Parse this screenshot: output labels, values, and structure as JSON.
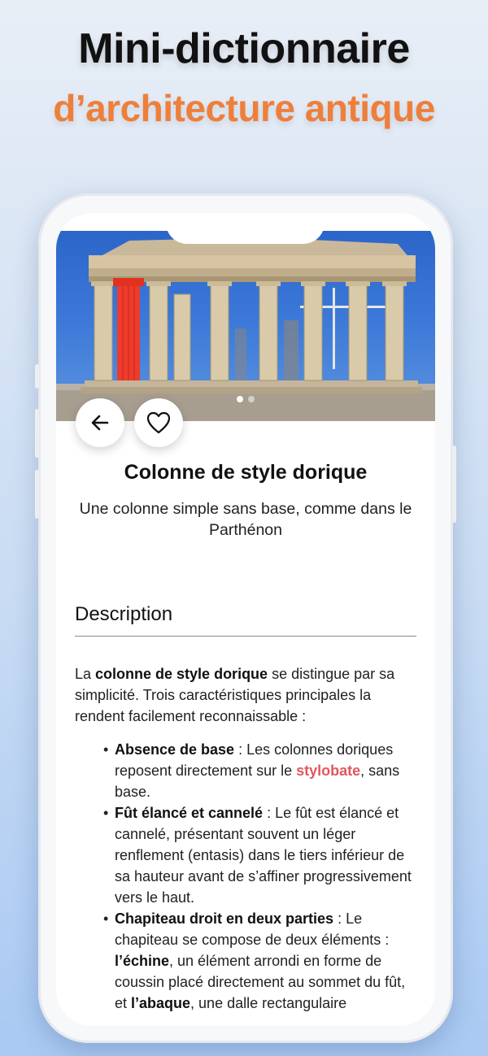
{
  "promo": {
    "title": "Mini-dictionnaire",
    "subtitle": "d’architecture antique"
  },
  "hero": {
    "image_alt": "Parthénon avec une colonne dorique en rouge",
    "highlight_color": "#ee3b2b",
    "page_count": 2,
    "active_page": 1
  },
  "actions": {
    "back_icon": "arrow-left-icon",
    "favorite_icon": "heart-outline-icon"
  },
  "entry": {
    "title": "Colonne de style dorique",
    "subtitle": "Une colonne simple sans base, comme dans le Parthénon"
  },
  "description": {
    "heading": "Description",
    "intro_before": "La ",
    "intro_term": "colonne de style dorique",
    "intro_after": " se distingue par sa simplicité. Trois caractéristiques principales la rendent facilement reconnaissable :",
    "items": [
      {
        "term": "Absence de base",
        "text_before": " : Les colonnes doriques reposent directement sur le ",
        "link": "stylobate",
        "text_after": ", sans base."
      },
      {
        "term": "Fût élancé et cannelé",
        "text": " : Le fût est élancé et cannelé, présentant souvent un léger renflement (entasis) dans le tiers inférieur de sa hauteur avant de s’affiner progressivement vers le haut."
      },
      {
        "term": "Chapiteau droit en deux parties",
        "text_before": " : Le chapiteau se compose de deux éléments : ",
        "term2": "l’échine",
        "text_middle": ", un élément arrondi en forme de coussin placé directement au sommet du fût, et ",
        "term3": "l’abaque",
        "text_after": ", une dalle rectangulaire"
      }
    ]
  },
  "colors": {
    "accent_orange": "#ee7f3b",
    "link_red": "#e0575f"
  }
}
